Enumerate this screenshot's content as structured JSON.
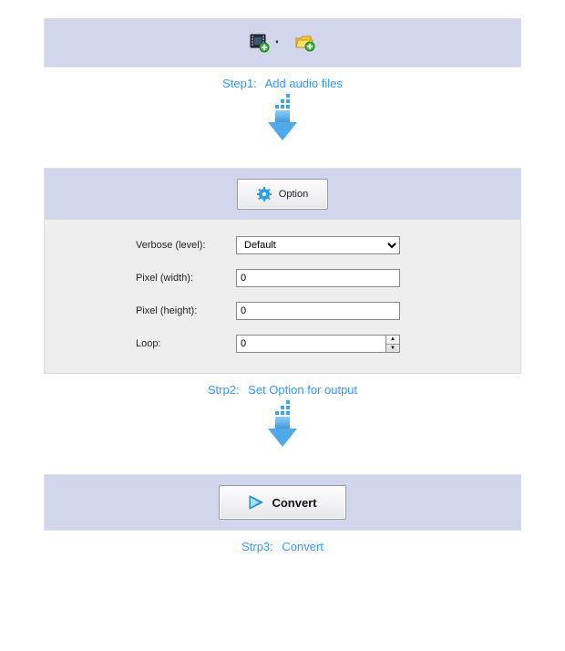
{
  "step1": {
    "caption_label": "Step1:",
    "caption_text": "Add audio files"
  },
  "step2": {
    "option_button": "Option",
    "fields": {
      "verbose_label": "Verbose (level):",
      "verbose_value": "Default",
      "pixel_width_label": "Pixel (width):",
      "pixel_width_value": "0",
      "pixel_height_label": "Pixel (height):",
      "pixel_height_value": "0",
      "loop_label": "Loop:",
      "loop_value": "0"
    },
    "caption_label": "Strp2:",
    "caption_text": "Set Option for output"
  },
  "step3": {
    "convert_button": "Convert",
    "caption_label": "Strp3:",
    "caption_text": "Convert"
  }
}
